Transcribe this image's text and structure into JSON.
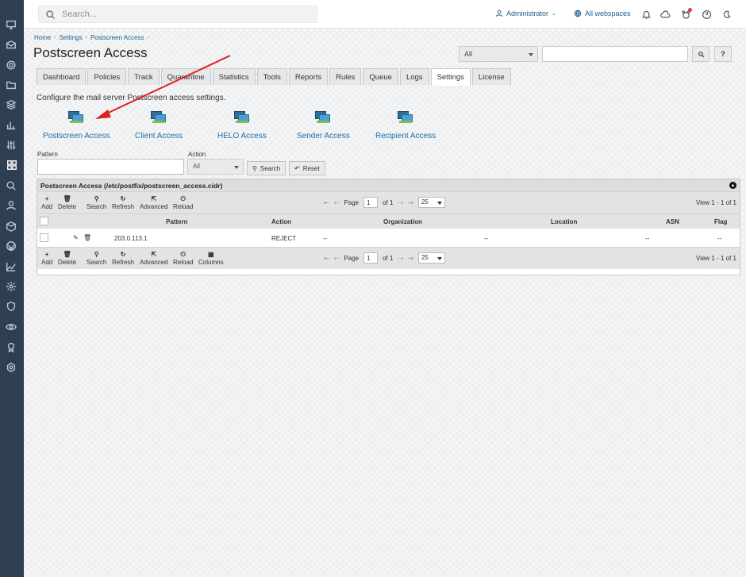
{
  "header": {
    "search_placeholder": "Search...",
    "user_label": "Administrator",
    "webspaces_label": "All webspaces"
  },
  "breadcrumb": [
    "Home",
    "Settings",
    "Postscreen Access"
  ],
  "page_title": "Postscreen Access",
  "top_filter": {
    "selected": "All",
    "search_btn": "⌕",
    "help_btn": "?"
  },
  "tabs": [
    "Dashboard",
    "Policies",
    "Track",
    "Quarantine",
    "Statistics",
    "Tools",
    "Reports",
    "Rules",
    "Queue",
    "Logs",
    "Settings",
    "License"
  ],
  "active_tab": "Settings",
  "description": "Configure the mail server Postscreen access settings.",
  "quick_links": [
    "Postscreen Access",
    "Client Access",
    "HELO Access",
    "Sender Access",
    "Recipient Access"
  ],
  "filter": {
    "pattern_label": "Pattern",
    "action_label": "Action",
    "action_selected": "All",
    "search_btn": "Search",
    "reset_btn": "Reset"
  },
  "grid": {
    "caption": "Postscreen Access (/etc/postfix/postscreen_access.cidr)",
    "toolbar_top": [
      "Add",
      "Delete",
      "Search",
      "Refresh",
      "Advanced",
      "Reload"
    ],
    "toolbar_bottom": [
      "Add",
      "Delete",
      "Search",
      "Refresh",
      "Advanced",
      "Reload",
      "Columns"
    ],
    "pager": {
      "page_label": "Page",
      "page_value": "1",
      "of_label": "of 1",
      "page_size": "25"
    },
    "view_info": "View 1 - 1 of 1",
    "columns": [
      "Pattern",
      "Action",
      "Organization",
      "Location",
      "ASN",
      "Flag"
    ],
    "rows": [
      {
        "pattern": "203.0.113.1",
        "action": "REJECT",
        "organization": "--",
        "location": "--",
        "asn": "--",
        "flag": "--"
      }
    ]
  },
  "colors": {
    "rail": "#2e3f52",
    "link": "#1f6fa8",
    "annotation_arrow": "#e02020"
  }
}
